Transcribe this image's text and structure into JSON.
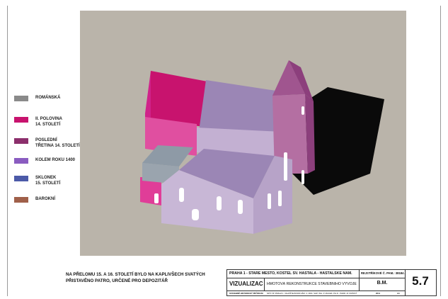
{
  "legend": [
    {
      "label": "ROMÁNSKÁ",
      "color": "#8a8a8a"
    },
    {
      "label": "II. POLOVINA\n14. STOLETÍ",
      "color": "#c8136e"
    },
    {
      "label": "POSLEDNÍ\nTŘETINA 14. STOLETÍ",
      "color": "#8c2f6c"
    },
    {
      "label": "KOLEM ROKU 1400",
      "color": "#8a5cc0"
    },
    {
      "label": "SKLONEK\n15. STOLETÍ",
      "color": "#4c5aa8"
    },
    {
      "label": "BAROKNÍ",
      "color": "#a0604a"
    }
  ],
  "note": "NA PŘELOMU 15. A 16. STOLETÍ BYLO NA KAPLIVŠECH SVATÝCH PŘISTAVĚNO PATRO, URČENÉ PRO DEPOZITÁŘ",
  "title_block": {
    "project": "PRAHA 1 - STARÉ MĚSTO, KOSTEL SV. HAŠTALA - HAŠTALSKÉ NÁM.",
    "registry": "REJSTŘÍKOVÉ Č. PAM.: 38184 / 1-21",
    "drawing_type": "VIZUALIZACE",
    "drawing_title": "HMOTOVÁ REKONSTRUKCE STAVEBNÍHO VÝVOJE",
    "author": "B.M.",
    "sheet_number": "5.7",
    "survey_label": "STAVEBNĚ HISTORICKÝ PRŮZKUM",
    "office_line": "NPÚ ÚP, PRAHA 1, VALDŠTEJNSKÉ NÁM. 3, ODD. SHP, ING. P. MACEK, PH.D., PHDR. M. PATRNÝ",
    "year": "2011",
    "format": "A4"
  }
}
